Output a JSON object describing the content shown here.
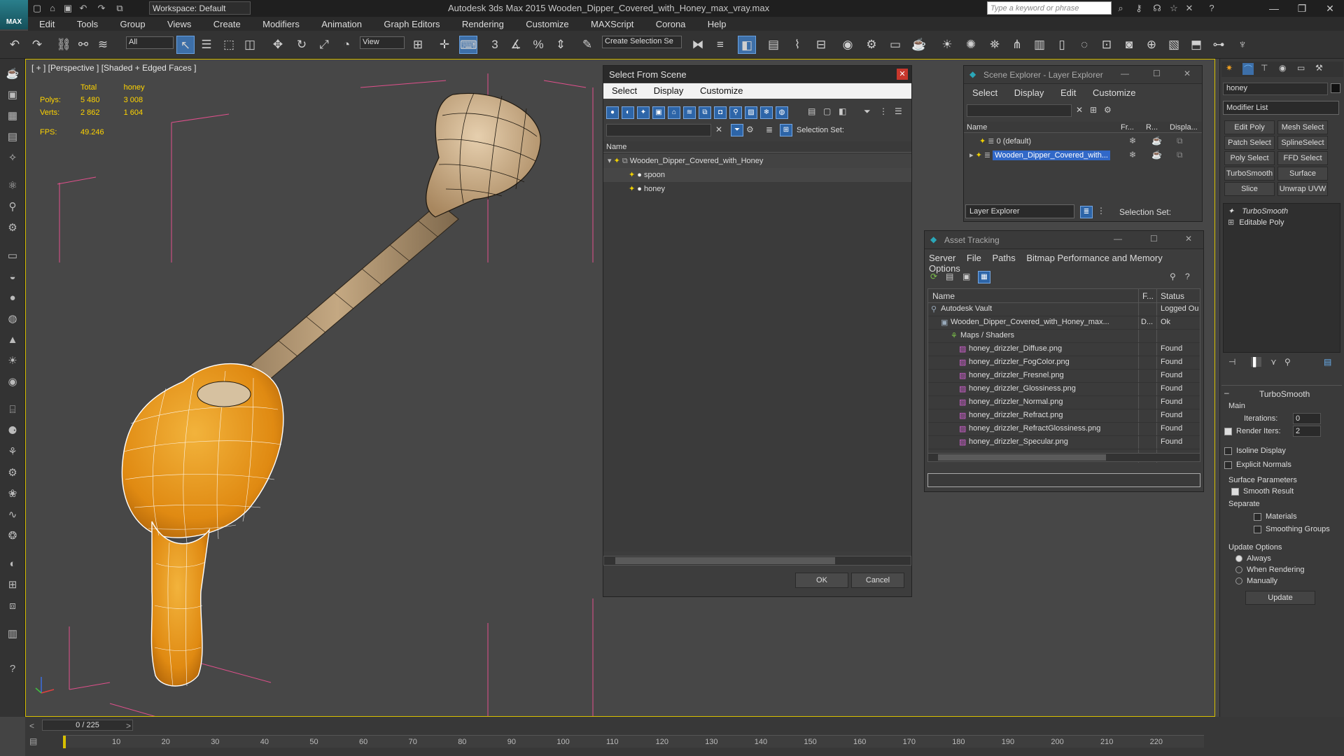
{
  "app": {
    "title": "Autodesk 3ds Max  2015     Wooden_Dipper_Covered_with_Honey_max_vray.max",
    "logo": "MAX",
    "workspace": "Workspace: Default",
    "search_placeholder": "Type a keyword or phrase"
  },
  "menu": [
    "Edit",
    "Tools",
    "Group",
    "Views",
    "Create",
    "Modifiers",
    "Animation",
    "Graph Editors",
    "Rendering",
    "Customize",
    "MAXScript",
    "Corona",
    "Help"
  ],
  "toolbar": {
    "selection_filter": "All",
    "ref_coord": "View",
    "create_selection_set": "Create Selection Se"
  },
  "viewport": {
    "label": "[ + ] [Perspective ] [Shaded + Edged Faces ]",
    "stats": {
      "header_total": "Total",
      "header_object": "honey",
      "polys_label": "Polys:",
      "polys_total": "5 480",
      "polys_object": "3 008",
      "verts_label": "Verts:",
      "verts_total": "2 862",
      "verts_object": "1 604",
      "fps_label": "FPS:",
      "fps_value": "49.246"
    }
  },
  "select_from_scene": {
    "title": "Select From Scene",
    "menu": [
      "Select",
      "Display",
      "Customize"
    ],
    "selection_set_label": "Selection Set:",
    "column_name": "Name",
    "items": [
      {
        "name": "Wooden_Dipper_Covered_with_Honey",
        "level": 0
      },
      {
        "name": "spoon",
        "level": 1
      },
      {
        "name": "honey",
        "level": 1
      }
    ],
    "ok": "OK",
    "cancel": "Cancel"
  },
  "scene_explorer": {
    "title": "Scene Explorer - Layer Explorer",
    "menu": [
      "Select",
      "Display",
      "Edit",
      "Customize"
    ],
    "columns": [
      "Name",
      "Fr...",
      "R...",
      "Displa..."
    ],
    "layers": [
      "0 (default)",
      "Wooden_Dipper_Covered_with..."
    ],
    "footer_dropdown": "Layer Explorer",
    "selection_set_label": "Selection Set:"
  },
  "asset_tracking": {
    "title": "Asset Tracking",
    "menu": [
      "Server",
      "File",
      "Paths",
      "Bitmap Performance and Memory",
      "Options"
    ],
    "columns": [
      "Name",
      "F...",
      "Status"
    ],
    "rows": [
      {
        "name": "Autodesk Vault",
        "f": "",
        "status": "Logged Ou"
      },
      {
        "name": "Wooden_Dipper_Covered_with_Honey_max...",
        "f": "D...",
        "status": "Ok"
      },
      {
        "name": "Maps / Shaders",
        "f": "",
        "status": ""
      },
      {
        "name": "honey_drizzler_Diffuse.png",
        "f": "",
        "status": "Found"
      },
      {
        "name": "honey_drizzler_FogColor.png",
        "f": "",
        "status": "Found"
      },
      {
        "name": "honey_drizzler_Fresnel.png",
        "f": "",
        "status": "Found"
      },
      {
        "name": "honey_drizzler_Glossiness.png",
        "f": "",
        "status": "Found"
      },
      {
        "name": "honey_drizzler_Normal.png",
        "f": "",
        "status": "Found"
      },
      {
        "name": "honey_drizzler_Refract.png",
        "f": "",
        "status": "Found"
      },
      {
        "name": "honey_drizzler_RefractGlossiness.png",
        "f": "",
        "status": "Found"
      },
      {
        "name": "honey_drizzler_Specular.png",
        "f": "",
        "status": "Found"
      }
    ]
  },
  "command_panel": {
    "object_name": "honey",
    "modifier_list": "Modifier List",
    "modifier_buttons": [
      "Edit Poly",
      "Mesh Select",
      "Patch Select",
      "SplineSelect",
      "Poly Select",
      "FFD Select",
      "TurboSmooth",
      "Surface Select",
      "Slice",
      "Unwrap UVW"
    ],
    "stack": [
      "TurboSmooth",
      "Editable Poly"
    ],
    "rollout_title": "TurboSmooth",
    "main_label": "Main",
    "iterations_label": "Iterations:",
    "iterations_value": "0",
    "render_iters_label": "Render Iters:",
    "render_iters_value": "2",
    "isoline_display": "Isoline Display",
    "explicit_normals": "Explicit Normals",
    "surface_params": "Surface Parameters",
    "smooth_result": "Smooth Result",
    "separate": "Separate",
    "materials": "Materials",
    "smoothing_groups": "Smoothing Groups",
    "update_options": "Update Options",
    "always": "Always",
    "when_rendering": "When Rendering",
    "manually": "Manually",
    "update_button": "Update"
  },
  "timeline": {
    "frame": "0 / 225",
    "ticks": [
      "10",
      "20",
      "30",
      "40",
      "50",
      "60",
      "70",
      "80",
      "90",
      "100",
      "110",
      "120",
      "130",
      "140",
      "150",
      "160",
      "170",
      "180",
      "190",
      "200",
      "210",
      "220"
    ]
  },
  "colors": {
    "honey": "#e69318",
    "wood": "#b89a73",
    "selection_blue": "#3d6fa8",
    "stats_yellow": "#ffd400",
    "viewport_border": "#d8c000"
  }
}
